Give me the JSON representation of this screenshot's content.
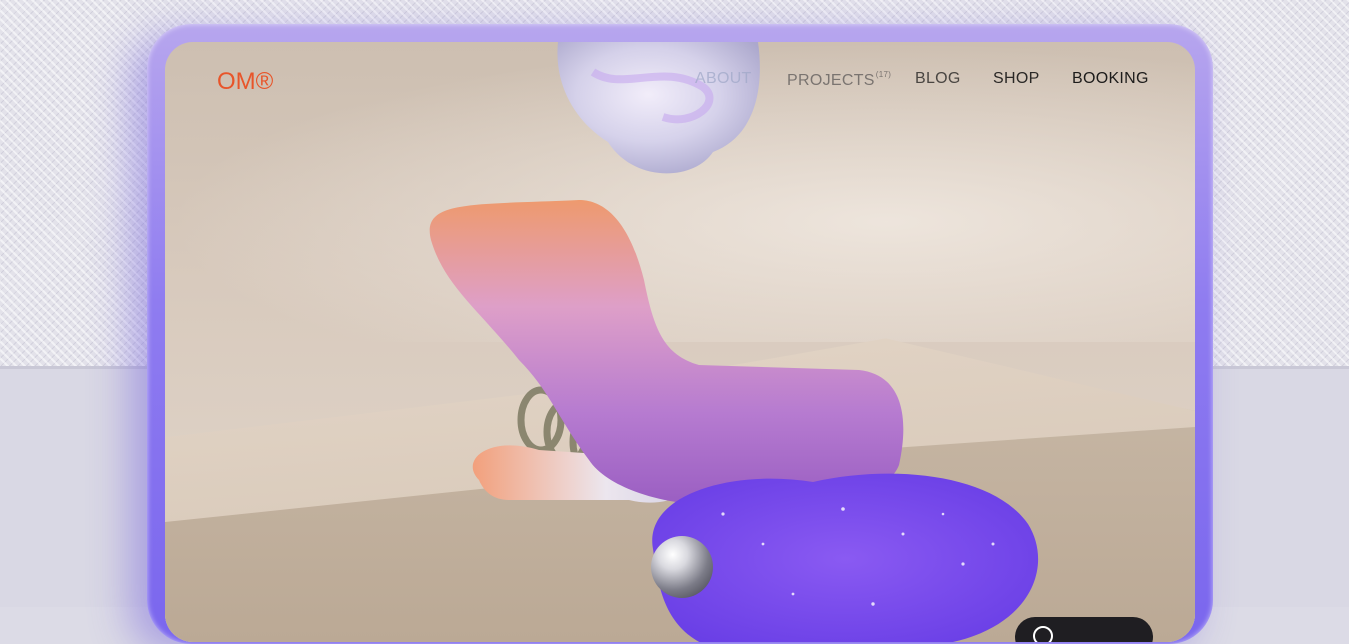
{
  "header": {
    "logo": "OM®"
  },
  "nav": {
    "about": "ABOUT",
    "projects": "PROJECTS",
    "projects_count": "(17)",
    "blog": "BLOG",
    "shop": "SHOP",
    "booking": "BOOKING"
  },
  "colors": {
    "logo": "#e8552a",
    "frame": "#8f7cf0",
    "pill": "#1f1e22"
  },
  "icons": {
    "pill_icon": "circle-icon"
  }
}
